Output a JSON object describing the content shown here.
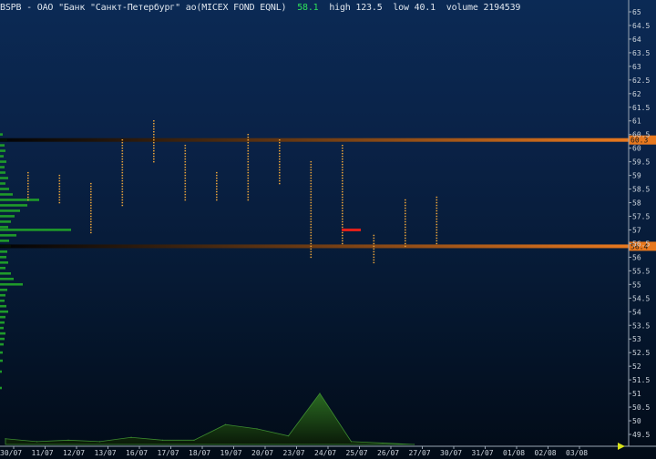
{
  "header": {
    "ticker": "BSPB",
    "name": "ОАО \"Банк \"Санкт-Петербург\" ао(MICEX FOND EQNL)",
    "last_price": "58.1",
    "high_text": "high 123.5",
    "low_text": "low 40.1",
    "volume_text": "volume 2194539"
  },
  "colors": {
    "background_top": "#0b2a55",
    "background_bottom": "#020b17",
    "price_text": "#2ee05a",
    "level_line": "#e8781e",
    "tick_dots": "#e8a23a",
    "profile_bars": "#1f9a2a",
    "volume_area": "#1c4a1a",
    "marker": "#e0201a"
  },
  "chart_data": {
    "type": "scatter",
    "title": "BSPB - ОАО \"Банк \"Санкт-Петербург\" ао(MICEX FOND EQNL)",
    "categories": [
      "30/07",
      "11/07",
      "12/07",
      "13/07",
      "16/07",
      "17/07",
      "18/07",
      "19/07",
      "20/07",
      "23/07",
      "24/07",
      "25/07",
      "26/07",
      "27/07",
      "30/07",
      "31/07",
      "01/08",
      "02/08",
      "03/08"
    ],
    "ylim": [
      49.5,
      65
    ],
    "y_ticks": [
      "65",
      "64.5",
      "64",
      "63.5",
      "63",
      "62.5",
      "62",
      "61.5",
      "61",
      "60.5",
      "60",
      "59.5",
      "59",
      "58.5",
      "58",
      "57.5",
      "57",
      "56.5",
      "56",
      "55.5",
      "55",
      "54.5",
      "54",
      "53.5",
      "53",
      "52.5",
      "52",
      "51.5",
      "51",
      "50.5",
      "50",
      "49.5"
    ],
    "levels": [
      {
        "name": "resistance",
        "value": 60.3,
        "label": "60.3"
      },
      {
        "name": "support",
        "value": 56.4,
        "label": "56.4"
      }
    ],
    "daily_ranges": [
      {
        "date": "30/07",
        "low": 58.1,
        "high": 59.1
      },
      {
        "date": "11/07",
        "low": 58.0,
        "high": 59.0
      },
      {
        "date": "12/07",
        "low": 56.9,
        "high": 58.7
      },
      {
        "date": "13/07",
        "low": 57.9,
        "high": 60.3
      },
      {
        "date": "16/07",
        "low": 59.5,
        "high": 61.0
      },
      {
        "date": "17/07",
        "low": 58.1,
        "high": 60.1
      },
      {
        "date": "18/07",
        "low": 58.1,
        "high": 59.1
      },
      {
        "date": "19/07",
        "low": 58.1,
        "high": 60.5
      },
      {
        "date": "20/07",
        "low": 58.7,
        "high": 60.3
      },
      {
        "date": "23/07",
        "low": 56.0,
        "high": 59.5
      },
      {
        "date": "24/07",
        "low": 56.5,
        "high": 60.1
      },
      {
        "date": "25/07",
        "low": 55.8,
        "high": 56.8
      },
      {
        "date": "26/07",
        "low": 56.4,
        "high": 58.1
      },
      {
        "date": "27/07",
        "low": 56.5,
        "high": 58.2
      }
    ],
    "marker": {
      "date": "24/07",
      "value": 57.0
    },
    "volume": [
      {
        "date": "30/07",
        "value": 4
      },
      {
        "date": "11/07",
        "value": 2
      },
      {
        "date": "12/07",
        "value": 3
      },
      {
        "date": "13/07",
        "value": 2
      },
      {
        "date": "16/07",
        "value": 5
      },
      {
        "date": "17/07",
        "value": 3
      },
      {
        "date": "18/07",
        "value": 3
      },
      {
        "date": "19/07",
        "value": 14
      },
      {
        "date": "20/07",
        "value": 11
      },
      {
        "date": "23/07",
        "value": 6
      },
      {
        "date": "24/07",
        "value": 36
      },
      {
        "date": "25/07",
        "value": 2
      },
      {
        "date": "26/07",
        "value": 1
      },
      {
        "date": "27/07",
        "value": 0
      }
    ],
    "volume_profile": [
      {
        "price": 60.5,
        "size": 3
      },
      {
        "price": 60.3,
        "size": 8
      },
      {
        "price": 60.1,
        "size": 5
      },
      {
        "price": 59.9,
        "size": 6
      },
      {
        "price": 59.7,
        "size": 4
      },
      {
        "price": 59.5,
        "size": 7
      },
      {
        "price": 59.3,
        "size": 5
      },
      {
        "price": 59.1,
        "size": 6
      },
      {
        "price": 58.9,
        "size": 9
      },
      {
        "price": 58.7,
        "size": 6
      },
      {
        "price": 58.5,
        "size": 10
      },
      {
        "price": 58.3,
        "size": 14
      },
      {
        "price": 58.1,
        "size": 43
      },
      {
        "price": 57.9,
        "size": 30
      },
      {
        "price": 57.7,
        "size": 22
      },
      {
        "price": 57.5,
        "size": 16
      },
      {
        "price": 57.3,
        "size": 12
      },
      {
        "price": 57.1,
        "size": 9
      },
      {
        "price": 57.0,
        "size": 78
      },
      {
        "price": 56.8,
        "size": 18
      },
      {
        "price": 56.6,
        "size": 10
      },
      {
        "price": 56.4,
        "size": 12
      },
      {
        "price": 56.2,
        "size": 8
      },
      {
        "price": 56.0,
        "size": 7
      },
      {
        "price": 55.8,
        "size": 9
      },
      {
        "price": 55.6,
        "size": 6
      },
      {
        "price": 55.4,
        "size": 12
      },
      {
        "price": 55.2,
        "size": 15
      },
      {
        "price": 55.0,
        "size": 25
      },
      {
        "price": 54.8,
        "size": 8
      },
      {
        "price": 54.6,
        "size": 6
      },
      {
        "price": 54.4,
        "size": 5
      },
      {
        "price": 54.2,
        "size": 7
      },
      {
        "price": 54.0,
        "size": 9
      },
      {
        "price": 53.8,
        "size": 6
      },
      {
        "price": 53.6,
        "size": 5
      },
      {
        "price": 53.4,
        "size": 4
      },
      {
        "price": 53.2,
        "size": 6
      },
      {
        "price": 53.0,
        "size": 5
      },
      {
        "price": 52.8,
        "size": 4
      },
      {
        "price": 52.5,
        "size": 3
      },
      {
        "price": 52.2,
        "size": 3
      },
      {
        "price": 51.8,
        "size": 2
      },
      {
        "price": 51.2,
        "size": 2
      }
    ]
  }
}
